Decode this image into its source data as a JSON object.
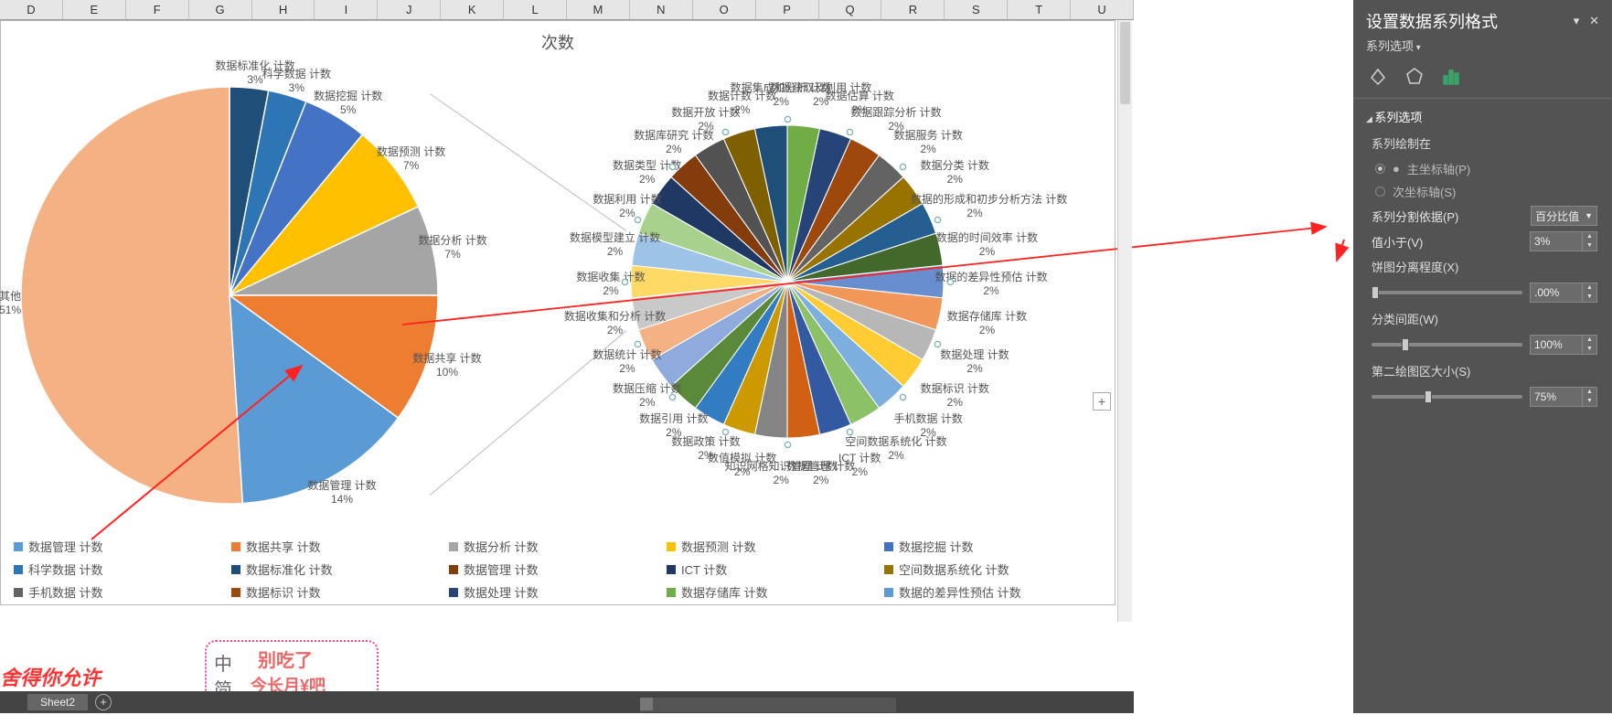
{
  "columns": [
    "D",
    "E",
    "F",
    "G",
    "H",
    "I",
    "J",
    "K",
    "L",
    "M",
    "N",
    "O",
    "P",
    "Q",
    "R",
    "S",
    "T",
    "U"
  ],
  "scroll_marks": [
    "0",
    "9"
  ],
  "chart_data": {
    "title": "次数",
    "type": "pie_of_pie",
    "main_pie": [
      {
        "name": "数据标准化 计数",
        "pct": 3,
        "color": "#1f4e79"
      },
      {
        "name": "科学数据 计数",
        "pct": 3,
        "color": "#2e75b6"
      },
      {
        "name": "数据挖掘 计数",
        "pct": 5,
        "color": "#4472c4"
      },
      {
        "name": "数据预测 计数",
        "pct": 7,
        "color": "#ffc000"
      },
      {
        "name": "数据分析 计数",
        "pct": 7,
        "color": "#a5a5a5"
      },
      {
        "name": "数据共享 计数",
        "pct": 10,
        "color": "#ed7d31"
      },
      {
        "name": "数据管理 计数",
        "pct": 14,
        "color": "#5b9bd5"
      },
      {
        "name": "其他",
        "pct": 51,
        "color": "#f4b183"
      }
    ],
    "second_pie": [
      {
        "name": "数据获取及利用 计数",
        "pct": 2
      },
      {
        "name": "数据估算 计数",
        "pct": 2
      },
      {
        "name": "数据跟踪分析 计数",
        "pct": 2
      },
      {
        "name": "数据服务 计数",
        "pct": 2
      },
      {
        "name": "数据分类 计数",
        "pct": 2
      },
      {
        "name": "数据的形成和初步分析方法 计数",
        "pct": 2
      },
      {
        "name": "数据的时间效率 计数",
        "pct": 2
      },
      {
        "name": "数据的差异性预估 计数",
        "pct": 2
      },
      {
        "name": "数据存储库 计数",
        "pct": 2
      },
      {
        "name": "数据处理 计数",
        "pct": 2
      },
      {
        "name": "数据标识 计数",
        "pct": 2
      },
      {
        "name": "手机数据 计数",
        "pct": 2
      },
      {
        "name": "空间数据系统化 计数",
        "pct": 2
      },
      {
        "name": "ICT 计数",
        "pct": 2
      },
      {
        "name": "数据管理 计数",
        "pct": 2
      },
      {
        "name": "知识网格知识管理 计数",
        "pct": 2
      },
      {
        "name": "数值模拟 计数",
        "pct": 2
      },
      {
        "name": "数据政策 计数",
        "pct": 2
      },
      {
        "name": "数据引用 计数",
        "pct": 2
      },
      {
        "name": "数据压缩 计数",
        "pct": 2
      },
      {
        "name": "数据统计 计数",
        "pct": 2
      },
      {
        "name": "数据收集和分析 计数",
        "pct": 2
      },
      {
        "name": "数据收集 计数",
        "pct": 2
      },
      {
        "name": "数据模型建立 计数",
        "pct": 2
      },
      {
        "name": "数据利用 计数",
        "pct": 2
      },
      {
        "name": "数据类型 计数",
        "pct": 2
      },
      {
        "name": "数据库研究 计数",
        "pct": 2
      },
      {
        "name": "数据开放 计数",
        "pct": 2
      },
      {
        "name": "数据计数 计数",
        "pct": 2
      },
      {
        "name": "数据集成和分析 计数",
        "pct": 2
      }
    ],
    "second_colors": [
      "#70ad47",
      "#264478",
      "#9e480e",
      "#636363",
      "#997300",
      "#255e91",
      "#43682b",
      "#698ed0",
      "#f1975a",
      "#b7b7b7",
      "#ffcd33",
      "#7cafdd",
      "#8cc168",
      "#335aa1",
      "#d26012",
      "#848484",
      "#cc9a00",
      "#327dc2",
      "#5a8a39",
      "#8faadc",
      "#f4b183",
      "#c9c9c9",
      "#ffd966",
      "#9dc3e6",
      "#a9d18e",
      "#203864",
      "#843c0c",
      "#525252",
      "#7f6000",
      "#1f4e79"
    ],
    "legend": [
      {
        "name": "数据管理 计数",
        "color": "#5b9bd5"
      },
      {
        "name": "数据共享 计数",
        "color": "#ed7d31"
      },
      {
        "name": "数据分析 计数",
        "color": "#a5a5a5"
      },
      {
        "name": "数据预测 计数",
        "color": "#ffc000"
      },
      {
        "name": "数据挖掘 计数",
        "color": "#4472c4"
      },
      {
        "name": "科学数据 计数",
        "color": "#2e75b6"
      },
      {
        "name": "数据标准化 计数",
        "color": "#1f4e79"
      },
      {
        "name": "数据管理 计数",
        "color": "#843c0c"
      },
      {
        "name": "ICT 计数",
        "color": "#203864"
      },
      {
        "name": "空间数据系统化 计数",
        "color": "#997300"
      },
      {
        "name": "手机数据 计数",
        "color": "#636363"
      },
      {
        "name": "数据标识 计数",
        "color": "#9e480e"
      },
      {
        "name": "数据处理 计数",
        "color": "#264478"
      },
      {
        "name": "数据存储库 计数",
        "color": "#70ad47"
      },
      {
        "name": "数据的差异性预估 计数",
        "color": "#5b9bd5"
      }
    ]
  },
  "sheet": {
    "active": "Sheet2"
  },
  "overlay": {
    "red_text": "舍得你允许"
  },
  "cartoon": {
    "l1": "中",
    "l2": "简",
    "r1": "别吃了",
    "r2": "今长月¥吧"
  },
  "pane": {
    "title": "设置数据系列格式",
    "subtitle": "系列选项",
    "section": "系列选项",
    "plot_on_label": "系列绘制在",
    "primary_axis": "主坐标轴(P)",
    "secondary_axis": "次坐标轴(S)",
    "split_by_label": "系列分割依据(P)",
    "split_by_value": "百分比值",
    "lt_label": "值小于(V)",
    "lt_value": "3%",
    "explosion_label": "饼图分离程度(X)",
    "explosion_value": ".00%",
    "gap_label": "分类间距(W)",
    "gap_value": "100%",
    "second_size_label": "第二绘图区大小(S)",
    "second_size_value": "75%"
  }
}
